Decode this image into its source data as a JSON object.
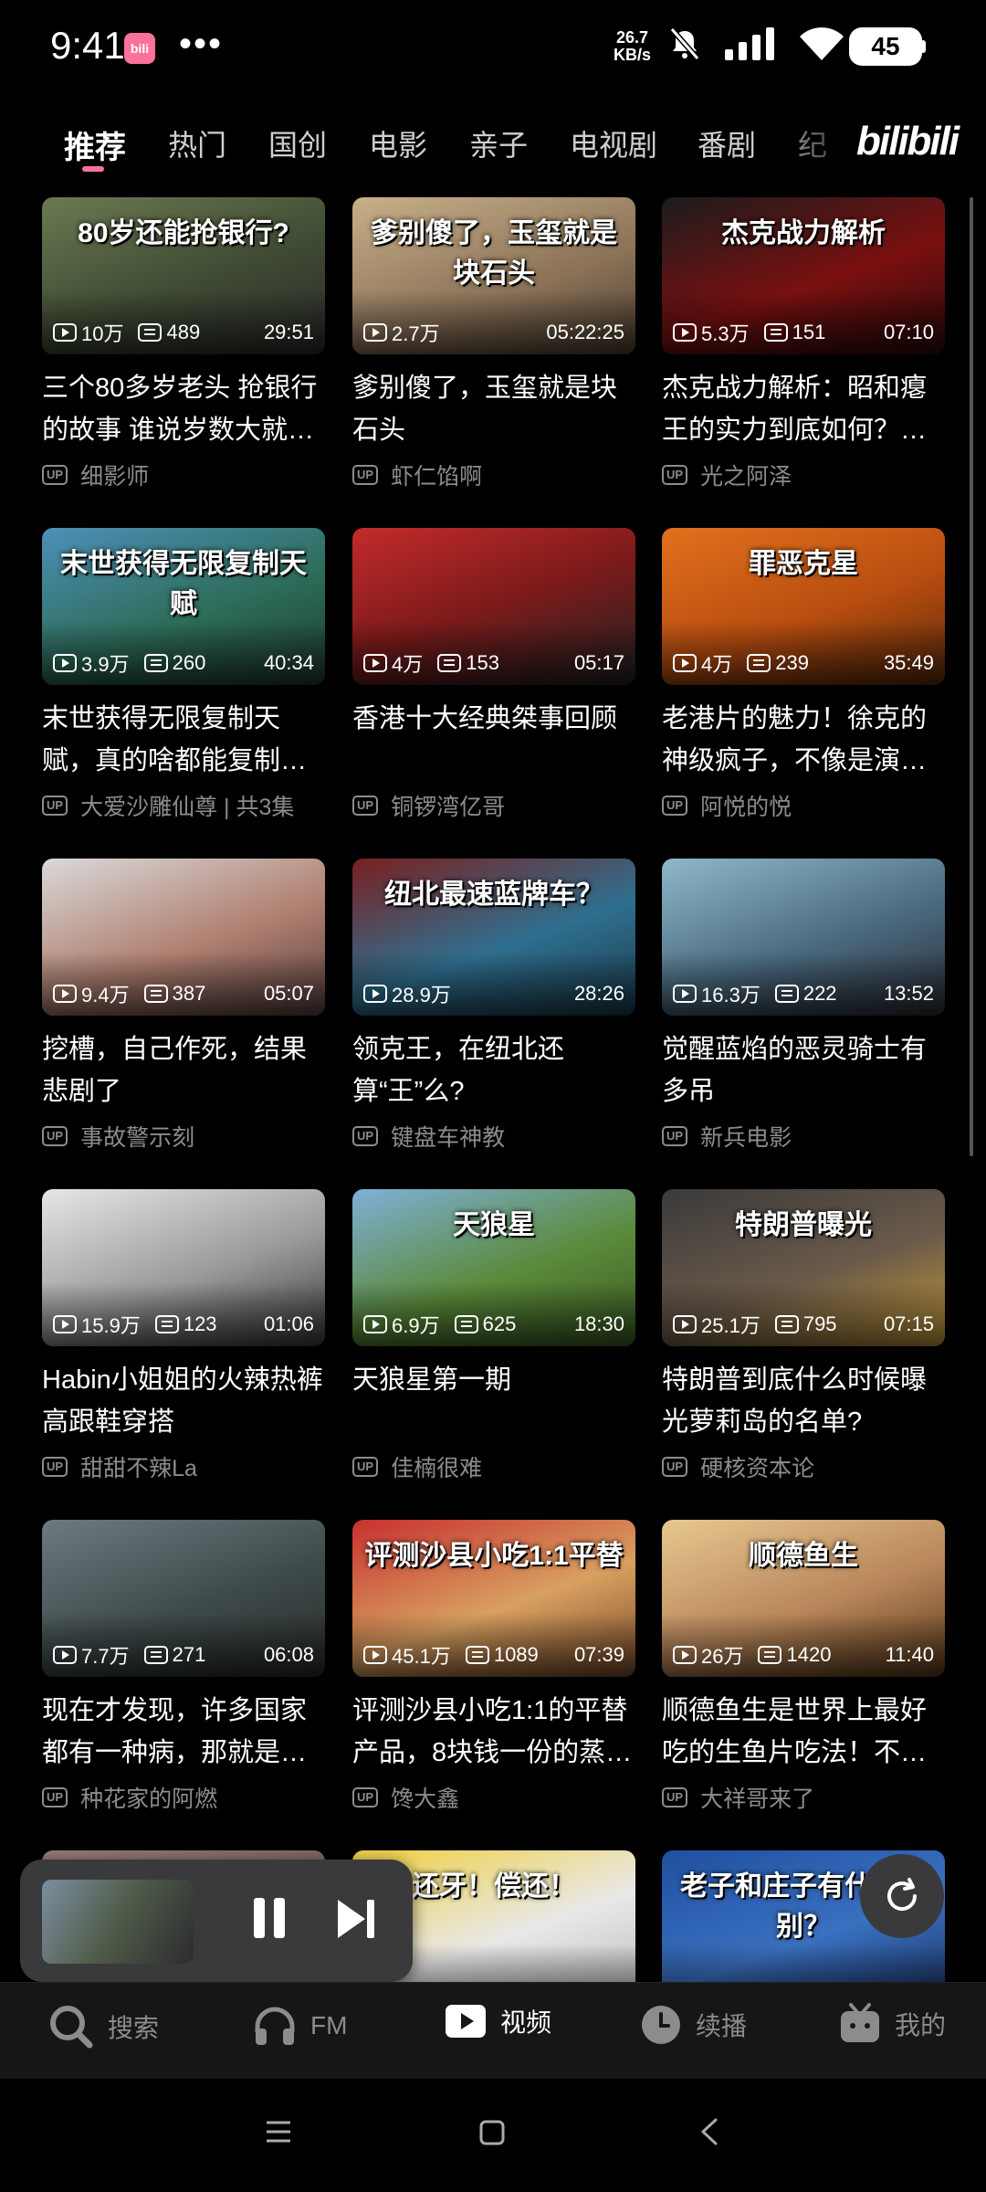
{
  "status_bar": {
    "time": "9:41",
    "app_badge": "bili",
    "dots": "•••",
    "net_speed_value": "26.7",
    "net_speed_unit": "KB/s",
    "battery": "45"
  },
  "tabs": [
    "推荐",
    "热门",
    "国创",
    "电影",
    "亲子",
    "电视剧",
    "番剧",
    "纪"
  ],
  "logo": "bilibili",
  "videos": [
    {
      "caption": "80岁还能抢银行?",
      "views": "10万",
      "danmaku": "489",
      "duration": "29:51",
      "title": "三个80多岁老头 抢银行的故事 谁说岁数大就…",
      "author": "细影师",
      "bg": "linear-gradient(160deg,#6a7a52,#3f4a33 55%,#2a2a2a)"
    },
    {
      "caption": "爹别傻了，玉玺就是块石头",
      "views": "2.7万",
      "danmaku": "",
      "duration": "05:22:25",
      "title": "爹别傻了，玉玺就是块石头",
      "author": "虾仁馅啊",
      "bg": "linear-gradient(160deg,#c8b08a,#8a7157 60%,#4b3e30)"
    },
    {
      "caption": "杰克战力解析",
      "views": "5.3万",
      "danmaku": "151",
      "duration": "07:10",
      "title": "杰克战力解析：昭和瘪王的实力到底如何？…",
      "author": "光之阿泽",
      "bg": "linear-gradient(160deg,#1c1c1c,#7a1010 55%,#2a0808)"
    },
    {
      "caption": "末世获得无限复制天赋",
      "views": "3.9万",
      "danmaku": "260",
      "duration": "40:34",
      "title": "末世获得无限复制天赋，真的啥都能复制…",
      "author": "大爱沙雕仙尊 | 共3集",
      "bg": "linear-gradient(160deg,#4e8fb8,#2d6d5a 55%,#1e3a30)"
    },
    {
      "caption": "",
      "views": "4万",
      "danmaku": "153",
      "duration": "05:17",
      "title": "香港十大经典桀事回顾",
      "author": "铜锣湾亿哥",
      "bg": "linear-gradient(160deg,#c42b2b,#7b1a1a 50%,#222)"
    },
    {
      "caption": "罪恶克星",
      "views": "4万",
      "danmaku": "239",
      "duration": "35:49",
      "title": "老港片的魅力！徐克的神级疯子，不像是演…",
      "author": "阿悦的悦",
      "bg": "linear-gradient(160deg,#e2711d,#b84d10 55%,#5a2a0a)"
    },
    {
      "caption": "",
      "views": "9.4万",
      "danmaku": "387",
      "duration": "05:07",
      "title": "挖槽，自己作死，结果悲剧了",
      "author": "事故警示刻",
      "bg": "linear-gradient(160deg,#d9d9d9,#b08070 55%,#5a4040)"
    },
    {
      "caption": "纽北最速蓝牌车？",
      "views": "28.9万",
      "danmaku": "",
      "duration": "28:26",
      "title": "领克王，在纽北还算“王”么?",
      "author": "键盘车神教",
      "bg": "linear-gradient(160deg,#7a2020,#2f6f8f 55%,#1a3a4a)"
    },
    {
      "caption": "",
      "views": "16.3万",
      "danmaku": "222",
      "duration": "13:52",
      "title": "觉醒蓝焰的恶灵骑士有多吊",
      "author": "新兵电影",
      "bg": "linear-gradient(160deg,#8fb8c9,#4a6a80 55%,#2b2b33)"
    },
    {
      "caption": "",
      "views": "15.9万",
      "danmaku": "123",
      "duration": "01:06",
      "title": "Habin小姐姐的火辣热裤高跟鞋穿搭",
      "author": "甜甜不辣La",
      "bg": "linear-gradient(160deg,#e6e6e6,#9a9a9a 55%,#3a3a3a)"
    },
    {
      "caption": "天狼星",
      "views": "6.9万",
      "danmaku": "625",
      "duration": "18:30",
      "title": "天狼星第一期",
      "author": "佳楠很难",
      "bg": "linear-gradient(160deg,#7fb0d8,#5a8a3a 55%,#3a5a22)"
    },
    {
      "caption": "特朗普曝光",
      "views": "25.1万",
      "danmaku": "795",
      "duration": "07:15",
      "title": "特朗普到底什么时候曝光萝莉岛的名单?",
      "author": "硬核资本论",
      "bg": "linear-gradient(160deg,#3a3a3a,#6a5a4a 55%,#c89a3a)"
    },
    {
      "caption": "",
      "views": "7.7万",
      "danmaku": "271",
      "duration": "06:08",
      "title": "现在才发现，许多国家都有一种病，那就是…",
      "author": "种花家的阿燃",
      "bg": "linear-gradient(160deg,#6e7a80,#3e4a4a 55%,#2a2a2a)"
    },
    {
      "caption": "评测沙县小吃1:1平替",
      "views": "45.1万",
      "danmaku": "1089",
      "duration": "07:39",
      "title": "评测沙县小吃1:1的平替产品，8块钱一份的蒸…",
      "author": "馋大鑫",
      "bg": "linear-gradient(160deg,#c83030,#d8a060 55%,#7a4a2a)"
    },
    {
      "caption": "顺德鱼生",
      "views": "26万",
      "danmaku": "1420",
      "duration": "11:40",
      "title": "顺德鱼生是世界上最好吃的生鱼片吃法！不…",
      "author": "大祥哥来了",
      "bg": "linear-gradient(160deg,#e8c890,#b8865a 55%,#5a3a1a)"
    },
    {
      "caption": "",
      "views": "",
      "danmaku": "",
      "duration": "",
      "title": "",
      "author": "",
      "bg": "linear-gradient(160deg,#9a7a7a,#5a4a4a)"
    },
    {
      "caption": "还牙！偿还！",
      "views": "",
      "danmaku": "",
      "duration": "",
      "title": "",
      "author": "",
      "bg": "linear-gradient(160deg,#f0d040,#e8e8e8 55%,#bbb)"
    },
    {
      "caption": "老子和庄子有什么区别？",
      "views": "",
      "danmaku": "",
      "duration": "",
      "title": "",
      "author": "",
      "bg": "linear-gradient(160deg,#2050a0,#3a70c0 55%,#1a3060)"
    }
  ],
  "bottom_nav": [
    {
      "label": "搜索",
      "icon": "search-icon"
    },
    {
      "label": "FM",
      "icon": "headphones-icon"
    },
    {
      "label": "视频",
      "icon": "video-icon"
    },
    {
      "label": "续播",
      "icon": "clock-icon"
    },
    {
      "label": "我的",
      "icon": "tv-icon"
    }
  ],
  "colors": {
    "accent": "#fb7299",
    "background": "#000000",
    "secondary_text": "#8c8c8c"
  }
}
